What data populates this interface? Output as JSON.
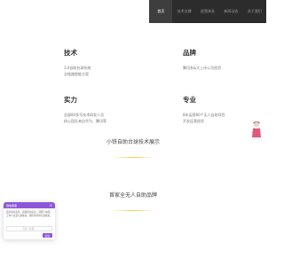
{
  "nav": {
    "items": [
      {
        "label": "首页",
        "active": true
      },
      {
        "label": "技术支撑",
        "active": false
      },
      {
        "label": "经营体系",
        "active": false
      },
      {
        "label": "新闻动态",
        "active": false
      },
      {
        "label": "关于我们",
        "active": false
      }
    ]
  },
  "features": {
    "tech": {
      "title": "技术",
      "lines": [
        "3.0自助台球系统",
        "全链路智能方案"
      ]
    },
    "brand": {
      "title": "品牌",
      "lines": [
        "腾讯系&大上市公司投资"
      ]
    },
    "power": {
      "title": "实力",
      "lines": [
        "总部80多号技术研发人员",
        "核心团队来自华为、腾讯等"
      ]
    },
    "pro": {
      "title": "专业",
      "lines": [
        "8年运营80个无人自助项目",
        "开发运营经验"
      ]
    }
  },
  "sections": {
    "tech_showcase": "小铁自助台球技术展示",
    "brand_showcase": "首家全无人自助品牌"
  },
  "chat": {
    "title": "微信客服",
    "close": "×",
    "message": "您好您好先生，感谢您的关注，请留下电话，工作人员会与您联系，我们将尽快与您联系。",
    "input_placeholder": "写说（必要）",
    "send_label": "提交"
  },
  "colors": {
    "nav_bg": "#2c2c2c",
    "nav_active_bg": "#3e3e3e",
    "accent_yellow": "#f5c842",
    "chat_purple": "#8e57d9"
  }
}
